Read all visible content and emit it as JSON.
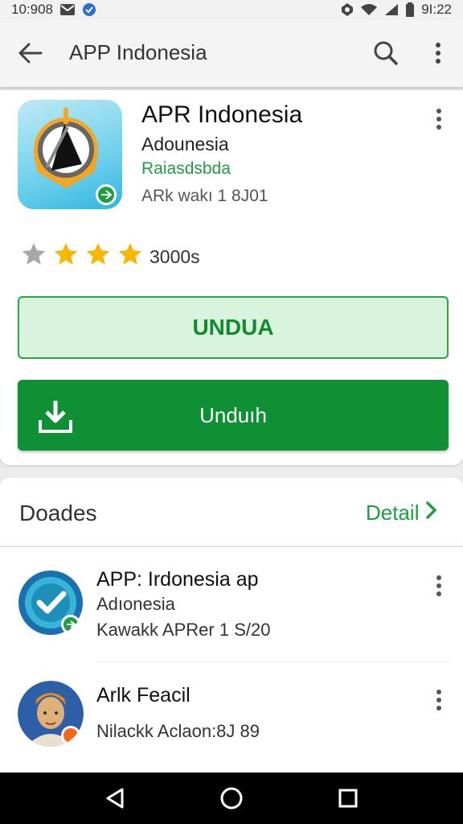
{
  "status_bar": {
    "time_left": "10:908",
    "time_right": "9I:22"
  },
  "app_bar": {
    "title": "APP Indonesia"
  },
  "app": {
    "name": "APR Indonesia",
    "developer": "Adounesia",
    "category": "Raiasdsbda",
    "version": "ARk wakı 1 8J01",
    "rating_count": "3000s",
    "stars": [
      {
        "icon": "star-icon",
        "filled": false
      },
      {
        "icon": "star-icon",
        "filled": true
      },
      {
        "icon": "star-icon",
        "filled": true
      },
      {
        "icon": "star-icon",
        "filled": true
      }
    ],
    "primary_outline_label": "UNDUA",
    "download_label": "Unduıh"
  },
  "section": {
    "title": "Doades",
    "link_label": "Detail"
  },
  "list": [
    {
      "title": "APP: Irdonesia ap",
      "subtitle": "Adıonesia",
      "meta": "Kawakk APRer 1 S/20",
      "icon": "check-badge-icon"
    },
    {
      "title": "Arlk Feacil",
      "subtitle": "",
      "meta": "Nilackk Aclaon:8J 89",
      "icon": "avatar-icon"
    }
  ],
  "colors": {
    "accent_green": "#109034",
    "link_green": "#1e9e3e",
    "outline_bg": "#d9f4de",
    "star_gold": "#f5b800",
    "star_gray": "#a8a8a8"
  }
}
